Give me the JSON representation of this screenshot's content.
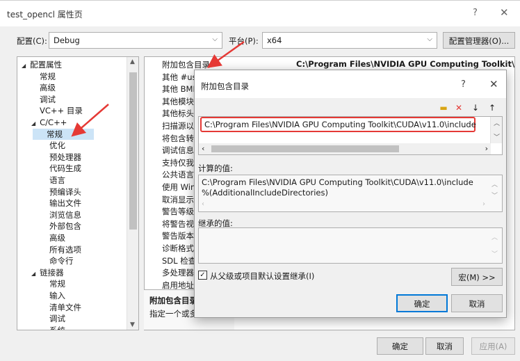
{
  "window": {
    "title": "test_opencl 属性页",
    "help": "?",
    "close": "✕"
  },
  "config_bar": {
    "config_label": "配置(C):",
    "config_value": "Debug",
    "platform_label": "平台(P):",
    "platform_value": "x64",
    "config_manager": "配置管理器(O)..."
  },
  "tree": {
    "items": [
      {
        "label": "配置属性",
        "level": 0,
        "expanded": true
      },
      {
        "label": "常规",
        "level": 1
      },
      {
        "label": "高级",
        "level": 1
      },
      {
        "label": "调试",
        "level": 1
      },
      {
        "label": "VC++ 目录",
        "level": 1
      },
      {
        "label": "C/C++",
        "level": 1,
        "expanded": true
      },
      {
        "label": "常规",
        "level": 2,
        "selected": true
      },
      {
        "label": "优化",
        "level": 2
      },
      {
        "label": "预处理器",
        "level": 2
      },
      {
        "label": "代码生成",
        "level": 2
      },
      {
        "label": "语言",
        "level": 2
      },
      {
        "label": "预编译头",
        "level": 2
      },
      {
        "label": "输出文件",
        "level": 2
      },
      {
        "label": "浏览信息",
        "level": 2
      },
      {
        "label": "外部包含",
        "level": 2
      },
      {
        "label": "高级",
        "level": 2
      },
      {
        "label": "所有选项",
        "level": 2
      },
      {
        "label": "命令行",
        "level": 2
      },
      {
        "label": "链接器",
        "level": 1,
        "expanded": true
      },
      {
        "label": "常规",
        "level": 2
      },
      {
        "label": "输入",
        "level": 2
      },
      {
        "label": "清单文件",
        "level": 2
      },
      {
        "label": "调试",
        "level": 2
      },
      {
        "label": "系统",
        "level": 2
      }
    ]
  },
  "grid": {
    "rows": [
      "附加包含目录",
      "其他 #usi",
      "其他 BMI",
      "其他模块",
      "其他标头",
      "扫描源以",
      "将包含转",
      "调试信息",
      "支持仅我",
      "公共语言",
      "使用 Win",
      "取消显示",
      "警告等级",
      "将警告视",
      "警告版本",
      "诊断格式",
      "SDL 检查",
      "多处理器",
      "启用地址"
    ],
    "first_value": "C:\\Program Files\\NVIDIA GPU Computing Toolkit\\CUDA",
    "desc_title": "附加包含目录",
    "desc_text": "指定一个或多"
  },
  "dialog": {
    "title": "附加包含目录",
    "help": "?",
    "close": "✕",
    "entries": [
      "C:\\Program Files\\NVIDIA GPU Computing Toolkit\\CUDA\\v11.0\\include"
    ],
    "evaluated_label": "计算的值:",
    "evaluated_lines": [
      "C:\\Program Files\\NVIDIA GPU Computing Toolkit\\CUDA\\v11.0\\include",
      "%(AdditionalIncludeDirectories)"
    ],
    "inherited_label": "继承的值:",
    "inherit_checkbox": "从父级或项目默认设置继承(I)",
    "inherit_checked": true,
    "macros_button": "宏(M) >>",
    "ok": "确定",
    "cancel": "取消"
  },
  "footer": {
    "ok": "确定",
    "cancel": "取消",
    "apply": "应用(A)"
  },
  "colors": {
    "highlight_border": "#e53935",
    "arrow": "#e53935",
    "selection": "#cce4f7",
    "accent": "#0078d7"
  }
}
